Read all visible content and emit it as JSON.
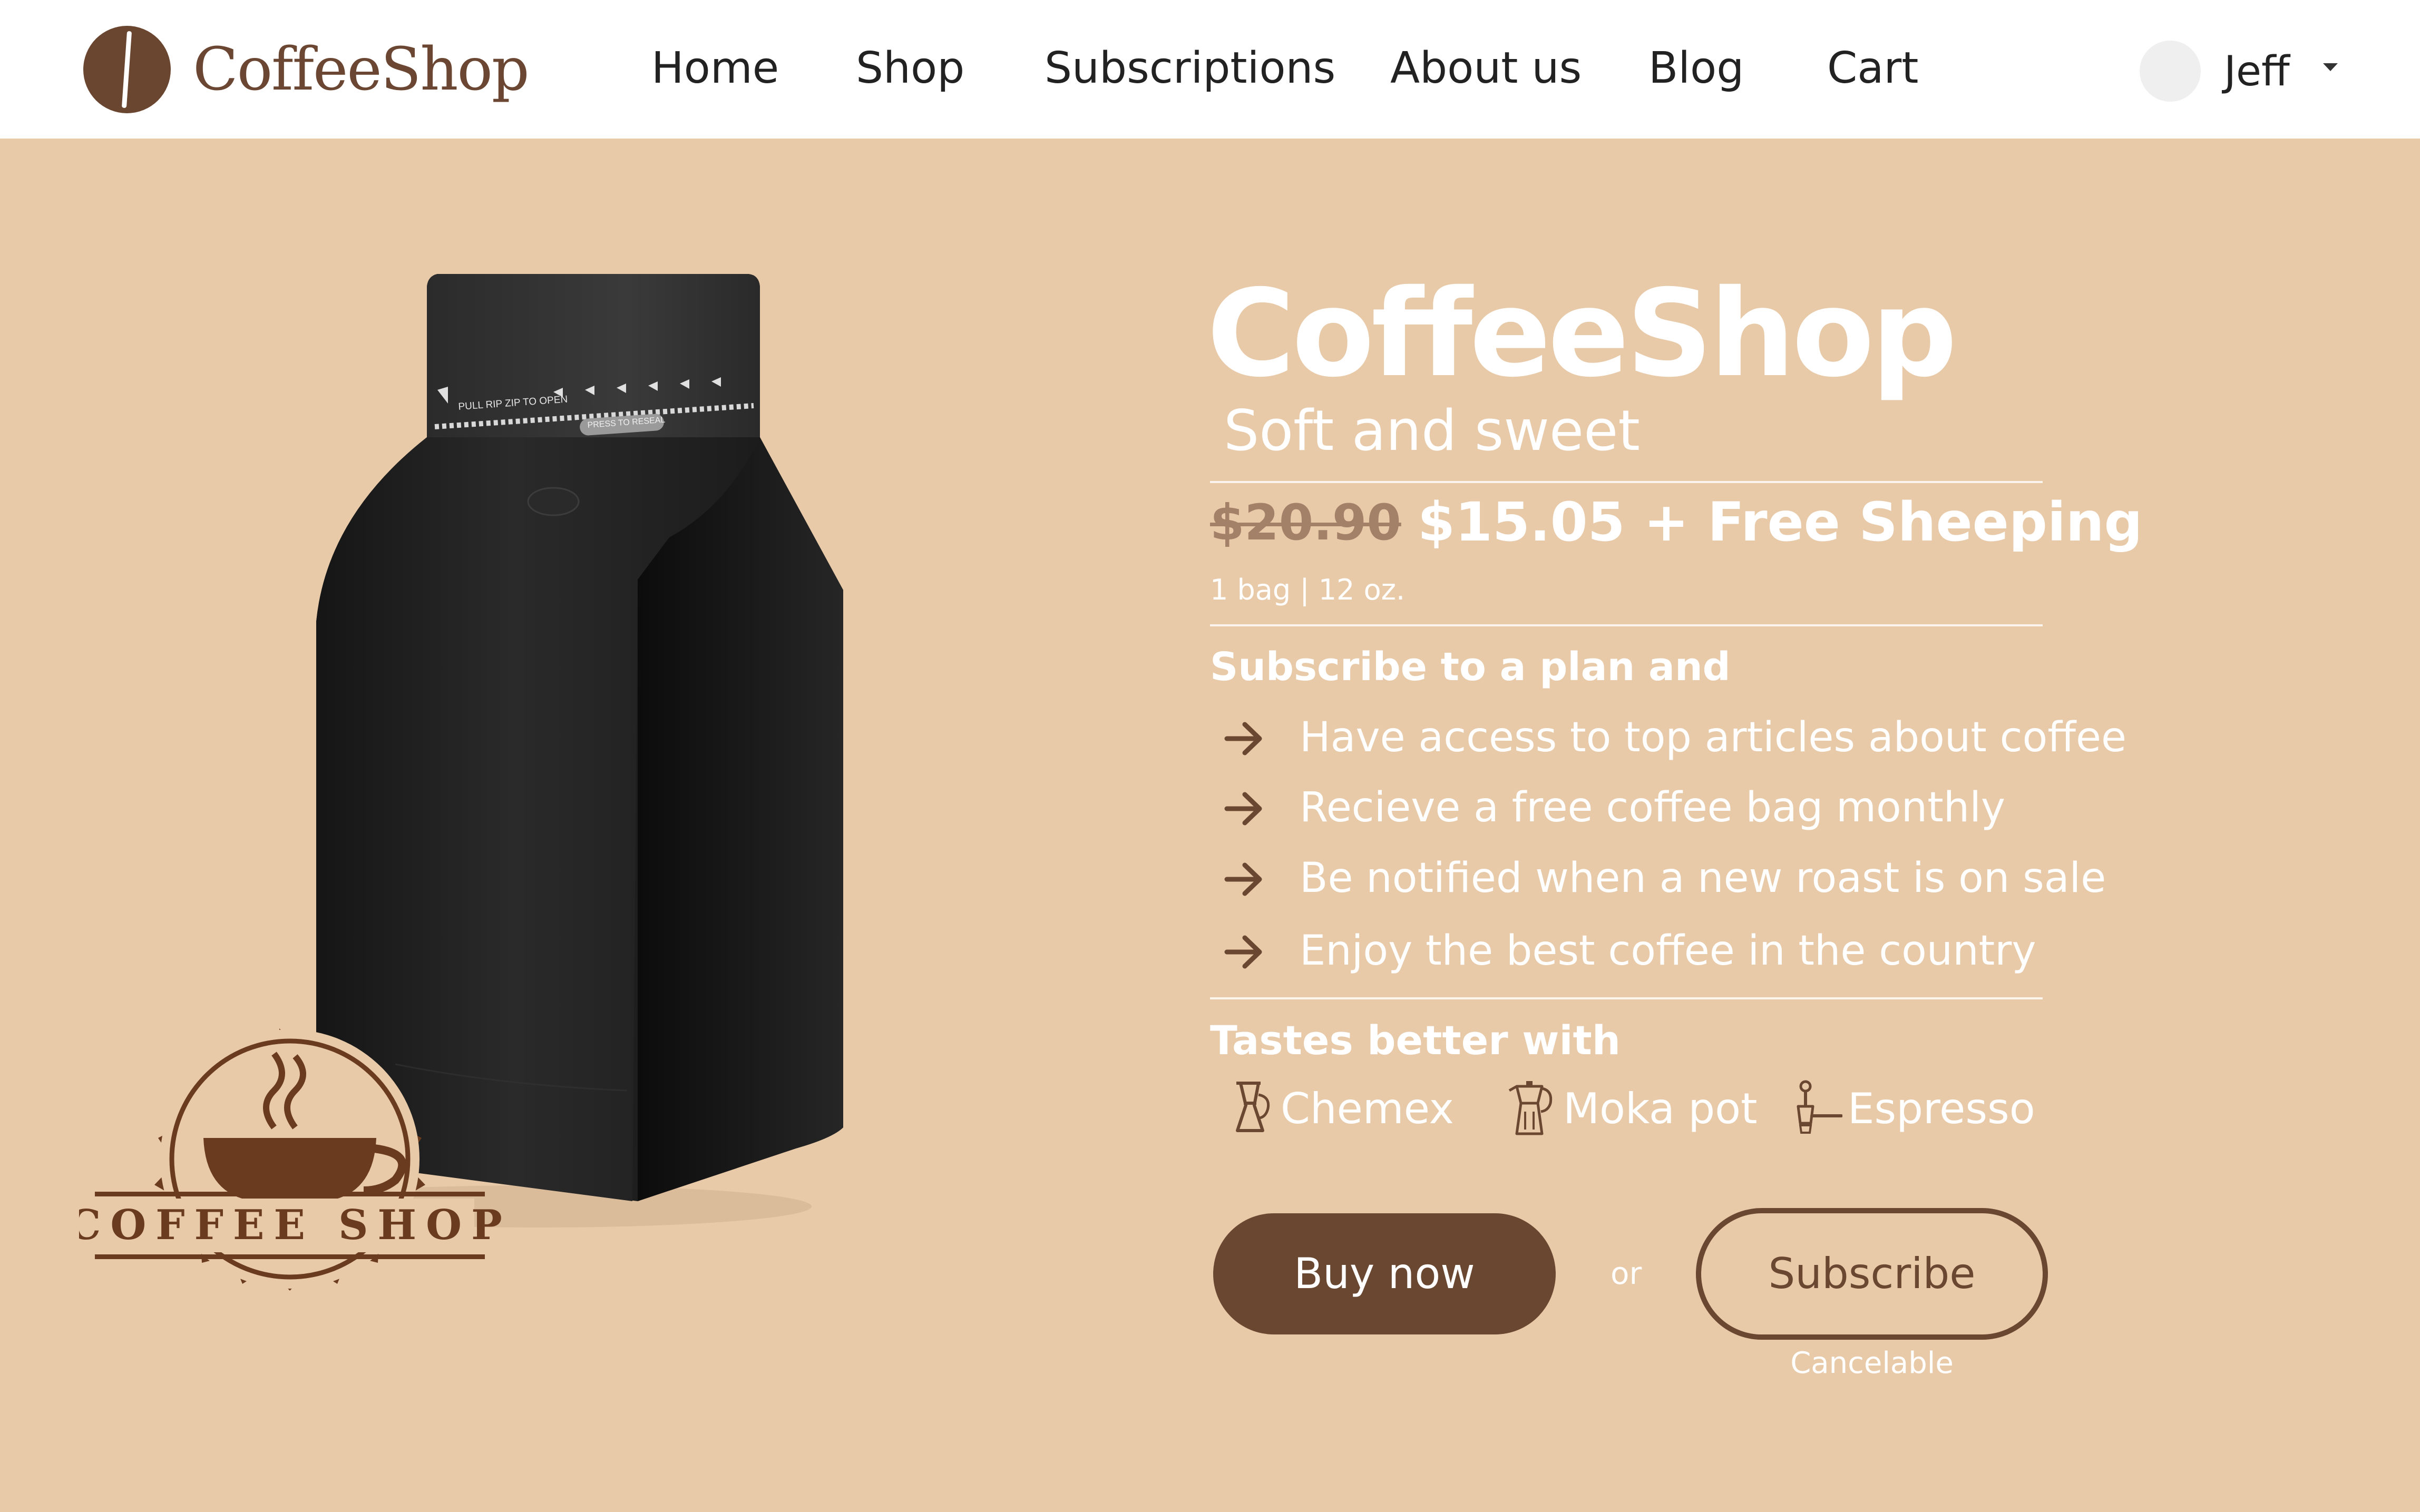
{
  "header": {
    "logo_icon": "coffee-bean-icon",
    "brand": "CoffeeShop",
    "nav": [
      "Home",
      "Shop",
      "Subscriptions",
      "About us",
      "Blog",
      "Cart"
    ],
    "user": {
      "name": "Jeff",
      "avatar_icon": "avatar-circle",
      "menu_icon": "caret-down-icon"
    }
  },
  "product": {
    "image": {
      "bag_print_top": "PULL RIP ZIP TO OPEN",
      "bag_print_reseal": "PRESS TO RESEAL",
      "badge_text": "COFFEE SHOP"
    },
    "title": "CoffeeShop",
    "subtitle": "Soft and sweet",
    "old_price": "$20.90",
    "price": "$15.05 + Free Sheeping",
    "unit": "1 bag | 12 oz.",
    "subscribe_heading": "Subscribe to a plan and",
    "benefits": [
      "Have access to top articles about coffee",
      "Recieve a free coffee bag monthly",
      "Be notified when a new roast is on sale",
      "Enjoy the best coffee in the country"
    ],
    "tastes_heading": "Tastes better with",
    "methods": [
      {
        "label": "Chemex",
        "icon": "chemex-icon"
      },
      {
        "label": "Moka pot",
        "icon": "moka-pot-icon"
      },
      {
        "label": "Espresso",
        "icon": "espresso-icon"
      }
    ]
  },
  "actions": {
    "buy_label": "Buy now",
    "or_label": "or",
    "subscribe_label": "Subscribe",
    "subscribe_note": "Cancelable"
  },
  "colors": {
    "background": "#e8caa8",
    "header_bg": "#ffffff",
    "brown": "#6a4731",
    "text_light": "#ffffff",
    "muted_price": "#a38068"
  }
}
